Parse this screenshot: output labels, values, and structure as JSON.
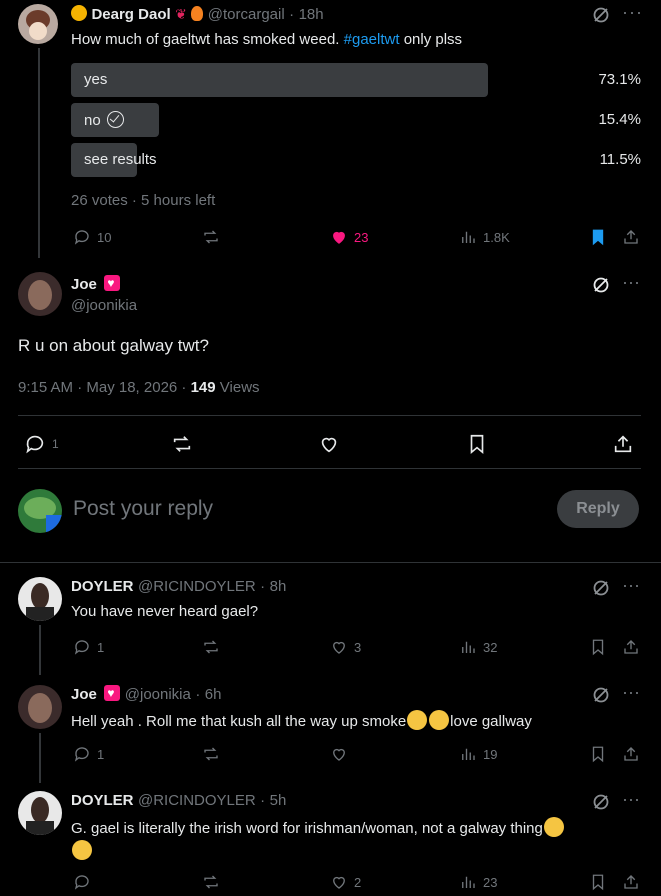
{
  "post1": {
    "name": "Dearg Daol",
    "handle": "@torcargail",
    "time": "18h",
    "text": "How much of gaeltwt has smoked weed.",
    "hashtag": "#gaeltwt",
    "text_after": "only plss",
    "poll": [
      {
        "label": "yes",
        "pct": "73.1%",
        "fraction": 0.731
      },
      {
        "label": "no",
        "pct": "15.4%",
        "fraction": 0.154
      },
      {
        "label": "see results",
        "pct": "11.5%",
        "fraction": 0.115
      }
    ],
    "poll_meta": "26 votes · 5 hours left",
    "replies": "10",
    "likes": "23",
    "views": "1.8K"
  },
  "main_post": {
    "name": "Joe",
    "handle": "@joonikia",
    "text": "R u on about galway twt?",
    "time": "9:15 AM · May 18, 2026 · ",
    "views_count": "149",
    "views_label": " Views",
    "replies": "1"
  },
  "compose": {
    "placeholder": "Post your reply",
    "button": "Reply"
  },
  "reply1": {
    "name": "DOYLER",
    "handle": "@RICINDOYLER",
    "time": "8h",
    "text": "You have never heard gael?",
    "replies": "1",
    "likes": "3",
    "views": "32"
  },
  "reply2": {
    "name": "Joe",
    "handle": "@joonikia",
    "time": "6h",
    "text_before": "Hell yeah . Roll me that kush all the way up smoke",
    "text_after": "love gallway",
    "replies": "1",
    "views": "19"
  },
  "reply3": {
    "name": "DOYLER",
    "handle": "@RICINDOYLER",
    "time": "5h",
    "text": "G. gael is literally the irish word for irishman/woman, not a galway thing",
    "likes": "2",
    "views": "23"
  },
  "colors": {
    "accent": "#1d9bf0",
    "like": "#f91880",
    "bg": "#000000",
    "muted": "#71767b"
  }
}
